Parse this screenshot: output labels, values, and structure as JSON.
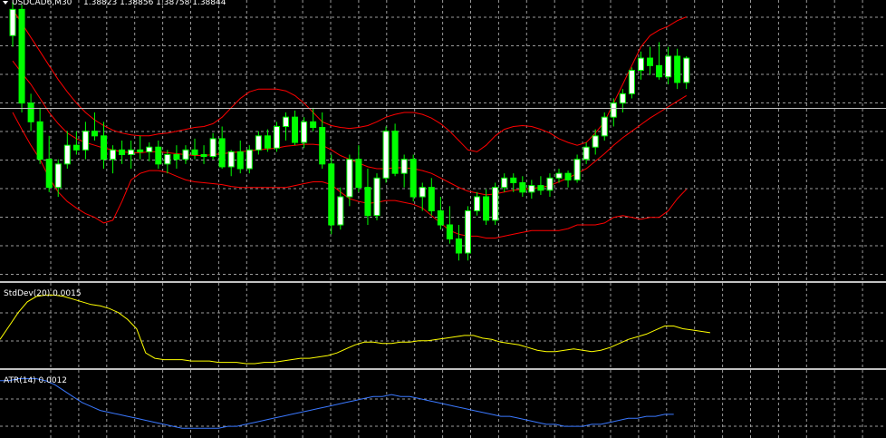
{
  "main_chart": {
    "symbol_label": "USDCAD6,M30",
    "ohlc_label": "1.38823 1.38856 1.38758 1.38844",
    "menu_icon": "triangle-down-icon",
    "price_line_value": 1.38844,
    "y_range": [
      1.37,
      1.4
    ],
    "candles": [
      [
        1.3962,
        1.3998,
        1.395,
        1.399
      ],
      [
        1.399,
        1.3995,
        1.388,
        1.389
      ],
      [
        1.389,
        1.39,
        1.386,
        1.387
      ],
      [
        1.387,
        1.3885,
        1.3825,
        1.383
      ],
      [
        1.383,
        1.3855,
        1.3795,
        1.38
      ],
      [
        1.38,
        1.383,
        1.379,
        1.3825
      ],
      [
        1.3825,
        1.386,
        1.382,
        1.3845
      ],
      [
        1.3845,
        1.386,
        1.3835,
        1.384
      ],
      [
        1.384,
        1.387,
        1.383,
        1.386
      ],
      [
        1.386,
        1.388,
        1.385,
        1.3855
      ],
      [
        1.3855,
        1.387,
        1.382,
        1.383
      ],
      [
        1.383,
        1.3845,
        1.3815,
        1.384
      ],
      [
        1.384,
        1.385,
        1.3825,
        1.3835
      ],
      [
        1.3835,
        1.385,
        1.382,
        1.384
      ],
      [
        1.384,
        1.3855,
        1.383,
        1.3838
      ],
      [
        1.3838,
        1.3848,
        1.3828,
        1.3843
      ],
      [
        1.3843,
        1.385,
        1.382,
        1.3825
      ],
      [
        1.3825,
        1.384,
        1.3815,
        1.3835
      ],
      [
        1.3835,
        1.3845,
        1.382,
        1.383
      ],
      [
        1.383,
        1.3845,
        1.3825,
        1.384
      ],
      [
        1.384,
        1.3852,
        1.383,
        1.3835
      ],
      [
        1.3835,
        1.3845,
        1.3825,
        1.3833
      ],
      [
        1.3833,
        1.3858,
        1.383,
        1.3852
      ],
      [
        1.3852,
        1.3865,
        1.382,
        1.3822
      ],
      [
        1.3822,
        1.384,
        1.3812,
        1.3838
      ],
      [
        1.3838,
        1.385,
        1.3815,
        1.382
      ],
      [
        1.382,
        1.3845,
        1.3815,
        1.384
      ],
      [
        1.384,
        1.386,
        1.3835,
        1.3855
      ],
      [
        1.3855,
        1.3862,
        1.3838,
        1.3842
      ],
      [
        1.3842,
        1.387,
        1.3838,
        1.3865
      ],
      [
        1.3865,
        1.388,
        1.385,
        1.3875
      ],
      [
        1.3875,
        1.3882,
        1.3845,
        1.3848
      ],
      [
        1.3848,
        1.3875,
        1.3842,
        1.387
      ],
      [
        1.387,
        1.3885,
        1.386,
        1.3864
      ],
      [
        1.3864,
        1.388,
        1.382,
        1.3825
      ],
      [
        1.3825,
        1.3835,
        1.375,
        1.376
      ],
      [
        1.376,
        1.38,
        1.3755,
        1.379
      ],
      [
        1.379,
        1.3835,
        1.378,
        1.383
      ],
      [
        1.383,
        1.3845,
        1.3795,
        1.38
      ],
      [
        1.38,
        1.382,
        1.376,
        1.377
      ],
      [
        1.377,
        1.3815,
        1.3765,
        1.381
      ],
      [
        1.381,
        1.3865,
        1.3805,
        1.386
      ],
      [
        1.386,
        1.3868,
        1.3812,
        1.3815
      ],
      [
        1.3815,
        1.3835,
        1.38,
        1.383
      ],
      [
        1.383,
        1.3835,
        1.3785,
        1.379
      ],
      [
        1.379,
        1.3805,
        1.3775,
        1.38
      ],
      [
        1.38,
        1.381,
        1.377,
        1.3775
      ],
      [
        1.3775,
        1.379,
        1.3755,
        1.376
      ],
      [
        1.376,
        1.378,
        1.374,
        1.3745
      ],
      [
        1.3745,
        1.376,
        1.3722,
        1.373
      ],
      [
        1.373,
        1.378,
        1.3722,
        1.3775
      ],
      [
        1.3775,
        1.3795,
        1.377,
        1.379
      ],
      [
        1.379,
        1.3798,
        1.376,
        1.3765
      ],
      [
        1.3765,
        1.3805,
        1.376,
        1.38
      ],
      [
        1.38,
        1.3815,
        1.3795,
        1.381
      ],
      [
        1.381,
        1.3815,
        1.3795,
        1.3805
      ],
      [
        1.3805,
        1.3812,
        1.379,
        1.3795
      ],
      [
        1.3795,
        1.3808,
        1.3788,
        1.3802
      ],
      [
        1.3802,
        1.3812,
        1.3792,
        1.3797
      ],
      [
        1.3797,
        1.3815,
        1.379,
        1.381
      ],
      [
        1.381,
        1.382,
        1.3805,
        1.3815
      ],
      [
        1.3815,
        1.3818,
        1.38,
        1.3808
      ],
      [
        1.3808,
        1.3835,
        1.3805,
        1.383
      ],
      [
        1.383,
        1.3848,
        1.3825,
        1.3843
      ],
      [
        1.3843,
        1.3862,
        1.3835,
        1.3855
      ],
      [
        1.3855,
        1.388,
        1.385,
        1.3875
      ],
      [
        1.3875,
        1.3895,
        1.3865,
        1.389
      ],
      [
        1.389,
        1.3905,
        1.388,
        1.39
      ],
      [
        1.39,
        1.3928,
        1.3895,
        1.3925
      ],
      [
        1.3925,
        1.3945,
        1.3915,
        1.3938
      ],
      [
        1.3938,
        1.395,
        1.392,
        1.393
      ],
      [
        1.393,
        1.3955,
        1.3915,
        1.3918
      ],
      [
        1.3918,
        1.395,
        1.391,
        1.394
      ],
      [
        1.394,
        1.3948,
        1.3905,
        1.3912
      ],
      [
        1.3912,
        1.394,
        1.3905,
        1.3938
      ]
    ],
    "bands_upper": [
      1.399,
      1.3975,
      1.396,
      1.3945,
      1.393,
      1.3915,
      1.3902,
      1.389,
      1.388,
      1.3872,
      1.3866,
      1.3861,
      1.3858,
      1.3856,
      1.3855,
      1.3855,
      1.3857,
      1.3858,
      1.386,
      1.3862,
      1.3864,
      1.3865,
      1.3868,
      1.3875,
      1.3885,
      1.3895,
      1.3902,
      1.3905,
      1.3905,
      1.3905,
      1.3903,
      1.3898,
      1.389,
      1.388,
      1.387,
      1.3866,
      1.3864,
      1.3863,
      1.3864,
      1.3866,
      1.387,
      1.3875,
      1.3878,
      1.388,
      1.388,
      1.3878,
      1.3874,
      1.3868,
      1.386,
      1.385,
      1.384,
      1.3838,
      1.3845,
      1.3855,
      1.3862,
      1.3865,
      1.3866,
      1.3865,
      1.3862,
      1.3858,
      1.3852,
      1.3848,
      1.3845,
      1.3848,
      1.3858,
      1.387,
      1.389,
      1.391,
      1.393,
      1.395,
      1.3962,
      1.3968,
      1.3972,
      1.3978,
      1.3982
    ],
    "bands_middle": [
      1.3935,
      1.3922,
      1.391,
      1.3895,
      1.388,
      1.3868,
      1.3858,
      1.3852,
      1.3848,
      1.3845,
      1.3842,
      1.384,
      1.3838,
      1.3837,
      1.3837,
      1.3838,
      1.3838,
      1.3837,
      1.3836,
      1.3835,
      1.3834,
      1.3834,
      1.3835,
      1.3836,
      1.3837,
      1.3838,
      1.3839,
      1.384,
      1.3841,
      1.3842,
      1.3844,
      1.3845,
      1.3846,
      1.3846,
      1.3845,
      1.384,
      1.3834,
      1.383,
      1.3826,
      1.3822,
      1.382,
      1.382,
      1.3821,
      1.3821,
      1.382,
      1.3818,
      1.3815,
      1.381,
      1.3805,
      1.38,
      1.3796,
      1.3794,
      1.3792,
      1.3793,
      1.3795,
      1.3797,
      1.3798,
      1.3799,
      1.38,
      1.3802,
      1.3806,
      1.381,
      1.3815,
      1.382,
      1.3828,
      1.3836,
      1.3845,
      1.3853,
      1.386,
      1.3867,
      1.3874,
      1.388,
      1.3886,
      1.3892,
      1.3898
    ],
    "bands_lower": [
      1.388,
      1.3862,
      1.3845,
      1.383,
      1.381,
      1.3795,
      1.3785,
      1.3778,
      1.3772,
      1.3768,
      1.3762,
      1.3765,
      1.3785,
      1.3808,
      1.3815,
      1.3818,
      1.3818,
      1.3816,
      1.3812,
      1.3808,
      1.3806,
      1.3805,
      1.3804,
      1.3803,
      1.3801,
      1.38,
      1.38,
      1.38,
      1.38,
      1.38,
      1.38,
      1.3802,
      1.3804,
      1.3806,
      1.3806,
      1.3803,
      1.3795,
      1.3788,
      1.3785,
      1.3783,
      1.3784,
      1.3786,
      1.3786,
      1.3784,
      1.3782,
      1.3778,
      1.377,
      1.3762,
      1.3754,
      1.375,
      1.3748,
      1.3748,
      1.3746,
      1.3746,
      1.3748,
      1.375,
      1.3752,
      1.3754,
      1.3754,
      1.3754,
      1.3754,
      1.3756,
      1.376,
      1.376,
      1.376,
      1.3762,
      1.3768,
      1.377,
      1.3768,
      1.3766,
      1.3768,
      1.3768,
      1.3775,
      1.3788,
      1.3798
    ]
  },
  "stddev_panel": {
    "label": "StdDev(20) 0.0015",
    "line_color": "#ffff00",
    "y_range": [
      0,
      0.006
    ],
    "values": [
      0.002,
      0.003,
      0.004,
      0.0048,
      0.0052,
      0.0053,
      0.0053,
      0.0052,
      0.005,
      0.0048,
      0.0046,
      0.0045,
      0.0043,
      0.004,
      0.0035,
      0.0028,
      0.001,
      0.0006,
      0.0005,
      0.0005,
      0.0005,
      0.0004,
      0.0004,
      0.0004,
      0.0003,
      0.0003,
      0.0003,
      0.0002,
      0.0002,
      0.0003,
      0.0003,
      0.0004,
      0.0005,
      0.0006,
      0.0006,
      0.0007,
      0.0008,
      0.001,
      0.0013,
      0.0016,
      0.0018,
      0.0018,
      0.0017,
      0.0017,
      0.0018,
      0.0018,
      0.0019,
      0.0019,
      0.002,
      0.0021,
      0.0022,
      0.0023,
      0.0023,
      0.0021,
      0.002,
      0.0018,
      0.0017,
      0.0016,
      0.0014,
      0.0012,
      0.0011,
      0.0011,
      0.0012,
      0.0013,
      0.0012,
      0.0011,
      0.0012,
      0.0014,
      0.0017,
      0.002,
      0.0022,
      0.0024,
      0.0027,
      0.003,
      0.003,
      0.0028,
      0.0027,
      0.0026,
      0.0025
    ]
  },
  "atr_panel": {
    "label": "ATR(14) 0.0012",
    "line_color": "#3a78ff",
    "y_range": [
      0,
      0.0032
    ],
    "values": [
      0.0028,
      0.0028,
      0.0029,
      0.0029,
      0.0029,
      0.0028,
      0.0026,
      0.0023,
      0.002,
      0.0017,
      0.0015,
      0.0013,
      0.0012,
      0.0011,
      0.001,
      0.0009,
      0.0008,
      0.0007,
      0.0006,
      0.0005,
      0.0004,
      0.0004,
      0.0004,
      0.0004,
      0.0004,
      0.0005,
      0.0005,
      0.0006,
      0.0007,
      0.0008,
      0.0009,
      0.001,
      0.0011,
      0.0012,
      0.0013,
      0.0014,
      0.0015,
      0.0016,
      0.0017,
      0.0018,
      0.0019,
      0.002,
      0.002,
      0.0021,
      0.002,
      0.002,
      0.0019,
      0.0018,
      0.0017,
      0.0016,
      0.0015,
      0.0014,
      0.0013,
      0.0012,
      0.0011,
      0.001,
      0.001,
      0.0009,
      0.0008,
      0.0007,
      0.0006,
      0.0006,
      0.0005,
      0.0005,
      0.0005,
      0.0006,
      0.0006,
      0.0007,
      0.0008,
      0.0009,
      0.0009,
      0.001,
      0.001,
      0.0011,
      0.0011
    ]
  },
  "colors": {
    "background": "#000000",
    "grid": "#9a9a9a",
    "candle": "#00ff00",
    "bull_body": "#ffffff",
    "bear_body": "#00ff00",
    "bands": "#ff0000",
    "separator": "#c0c0c0",
    "price_line": "#c0c0c0",
    "text": "#ffffff"
  }
}
